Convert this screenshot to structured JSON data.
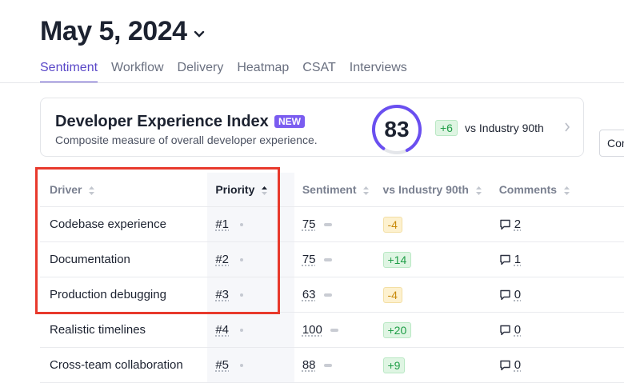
{
  "header": {
    "title": "May 5, 2024"
  },
  "tabs": [
    {
      "label": "Sentiment",
      "active": true
    },
    {
      "label": "Workflow"
    },
    {
      "label": "Delivery"
    },
    {
      "label": "Heatmap"
    },
    {
      "label": "CSAT"
    },
    {
      "label": "Interviews"
    }
  ],
  "index_card": {
    "title": "Developer Experience Index",
    "badge": "NEW",
    "subtitle": "Composite measure of overall developer experience.",
    "score": "83",
    "delta": "+6",
    "delta_label": "vs Industry 90th"
  },
  "compare_button": {
    "label": "Con"
  },
  "table": {
    "columns": {
      "driver": "Driver",
      "priority": "Priority",
      "sentiment": "Sentiment",
      "vs": "vs Industry 90th",
      "comments": "Comments"
    },
    "rows": [
      {
        "driver": "Codebase experience",
        "priority": "#1",
        "sentiment": "75",
        "vs": "-4",
        "vs_type": "neg",
        "comments": "2"
      },
      {
        "driver": "Documentation",
        "priority": "#2",
        "sentiment": "75",
        "vs": "+14",
        "vs_type": "pos",
        "comments": "1"
      },
      {
        "driver": "Production debugging",
        "priority": "#3",
        "sentiment": "63",
        "vs": "-4",
        "vs_type": "neg",
        "comments": "0"
      },
      {
        "driver": "Realistic timelines",
        "priority": "#4",
        "sentiment": "100",
        "vs": "+20",
        "vs_type": "pos",
        "comments": "0"
      },
      {
        "driver": "Cross-team collaboration",
        "priority": "#5",
        "sentiment": "88",
        "vs": "+9",
        "vs_type": "pos",
        "comments": "0"
      }
    ]
  },
  "colors": {
    "accent": "#5a48c8",
    "highlight": "#e8392c",
    "positive": "#1f9d47",
    "warning": "#c98a0a"
  }
}
